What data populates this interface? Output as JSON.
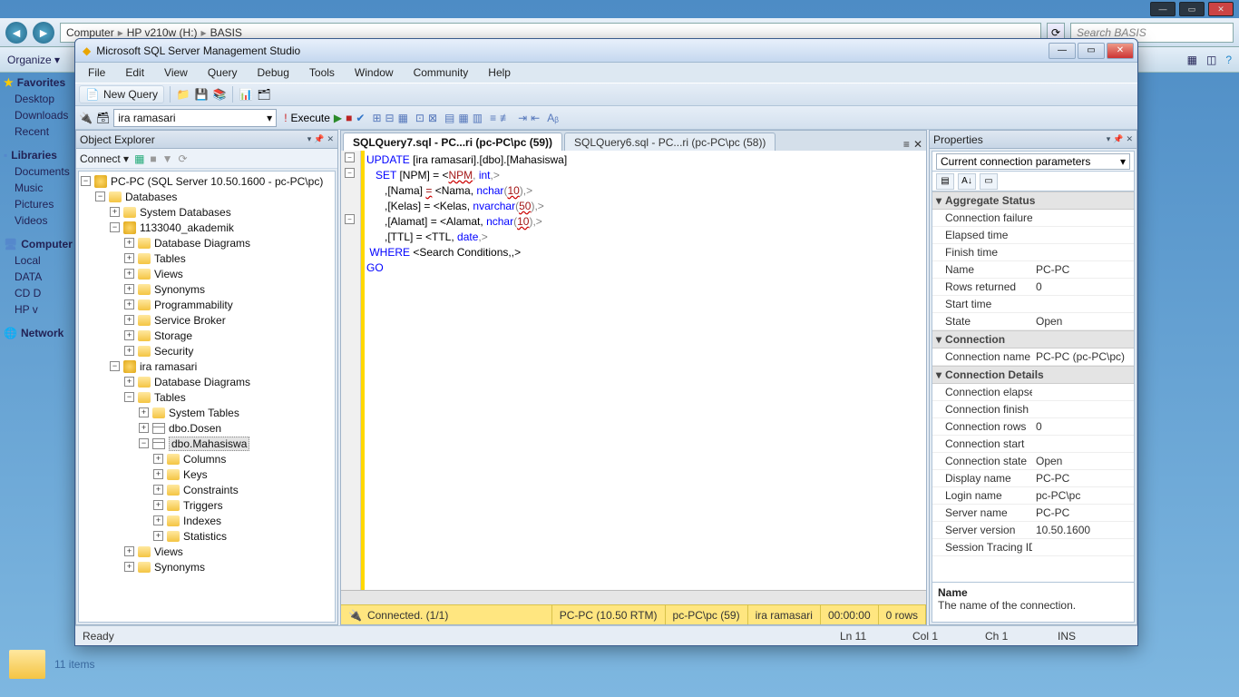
{
  "desktop": {
    "breadcrumb": [
      "Computer",
      "HP v210w (H:)",
      "BASIS"
    ],
    "search_placeholder": "Search BASIS",
    "organize": "Organize ▾",
    "items_text": "11 items",
    "nav": {
      "favorites": "Favorites",
      "desktop": "Desktop",
      "downloads": "Downloads",
      "recent": "Recent",
      "libraries": "Libraries",
      "documents": "Documents",
      "music": "Music",
      "pictures": "Pictures",
      "videos": "Videos",
      "computer": "Computer",
      "local": "Local",
      "data": "DATA",
      "cd": "CD D",
      "hp": "HP v",
      "network": "Network"
    }
  },
  "ssms": {
    "title": "Microsoft SQL Server Management Studio",
    "menu": [
      "File",
      "Edit",
      "View",
      "Query",
      "Debug",
      "Tools",
      "Window",
      "Community",
      "Help"
    ],
    "toolbar": {
      "new_query": "New Query"
    },
    "toolbar2": {
      "db": "ira ramasari",
      "execute": "Execute"
    },
    "object_explorer": {
      "title": "Object Explorer",
      "connect": "Connect ▾",
      "root": "PC-PC (SQL Server 10.50.1600 - pc-PC\\pc)",
      "databases": "Databases",
      "sysdb": "System Databases",
      "db1": "1133040_akademik",
      "db1_children": [
        "Database Diagrams",
        "Tables",
        "Views",
        "Synonyms",
        "Programmability",
        "Service Broker",
        "Storage",
        "Security"
      ],
      "db2": "ira ramasari",
      "db2_diag": "Database Diagrams",
      "db2_tables": "Tables",
      "sys_tables": "System Tables",
      "dosen": "dbo.Dosen",
      "mahasiswa": "dbo.Mahasiswa",
      "mhs_children": [
        "Columns",
        "Keys",
        "Constraints",
        "Triggers",
        "Indexes",
        "Statistics"
      ],
      "db2_rest": [
        "Views",
        "Synonyms"
      ]
    },
    "tabs": {
      "active": "SQLQuery7.sql - PC...ri (pc-PC\\pc (59))",
      "inactive": "SQLQuery6.sql - PC...ri (pc-PC\\pc (58))"
    },
    "code": {
      "l1a": "UPDATE",
      "l1b": " [ira ramasari].[dbo].[Mahasiswa]",
      "l2a": "   SET",
      "l2b": " [NPM] = <",
      "l2c": "NPM",
      "l2d": ", ",
      "l2e": "int",
      "l2f": ",>",
      "l3a": "      ,[Nama] ",
      "l3b": "=",
      "l3c": " <Nama, ",
      "l3d": "nchar",
      "l3e": "(",
      "l3f": "10",
      "l3g": "),>",
      "l4a": "      ,[Kelas] = <Kelas, ",
      "l4b": "nvarchar",
      "l4c": "(",
      "l4d": "50",
      "l4e": "),>",
      "l5a": "      ,[Alamat] = <Alamat, ",
      "l5b": "nchar",
      "l5c": "(",
      "l5d": "10",
      "l5e": "),>",
      "l6a": "      ,[TTL] = <TTL, ",
      "l6b": "date",
      "l6c": ",>",
      "l7a": " WHERE",
      "l7b": " <Search Conditions,,>",
      "l8": "GO"
    },
    "query_status": {
      "connected": "Connected. (1/1)",
      "server": "PC-PC (10.50 RTM)",
      "user": "pc-PC\\pc (59)",
      "db": "ira ramasari",
      "time": "00:00:00",
      "rows": "0 rows"
    },
    "statusbar": {
      "ready": "Ready",
      "ln": "Ln 11",
      "col": "Col 1",
      "ch": "Ch 1",
      "ins": "INS"
    },
    "properties": {
      "title": "Properties",
      "combo": "Current connection parameters",
      "categories": {
        "agg": "Aggregate Status",
        "conn": "Connection",
        "conn_det": "Connection Details"
      },
      "rows": {
        "conn_fail": "Connection failure",
        "elapsed": "Elapsed time",
        "finish": "Finish time",
        "name": "Name",
        "name_v": "PC-PC",
        "rows_ret": "Rows returned",
        "rows_ret_v": "0",
        "start": "Start time",
        "state": "State",
        "state_v": "Open",
        "conn_name": "Connection name",
        "conn_name_v": "PC-PC (pc-PC\\pc)",
        "conn_elapsed": "Connection elapsed",
        "conn_finish": "Connection finish",
        "conn_rows": "Connection rows",
        "conn_rows_v": "0",
        "conn_start": "Connection start",
        "conn_state": "Connection state",
        "conn_state_v": "Open",
        "disp_name": "Display name",
        "disp_name_v": "PC-PC",
        "login": "Login name",
        "login_v": "pc-PC\\pc",
        "srv_name": "Server name",
        "srv_name_v": "PC-PC",
        "srv_ver": "Server version",
        "srv_ver_v": "10.50.1600",
        "sess_trace": "Session Tracing ID"
      },
      "desc_title": "Name",
      "desc_text": "The name of the connection."
    }
  }
}
